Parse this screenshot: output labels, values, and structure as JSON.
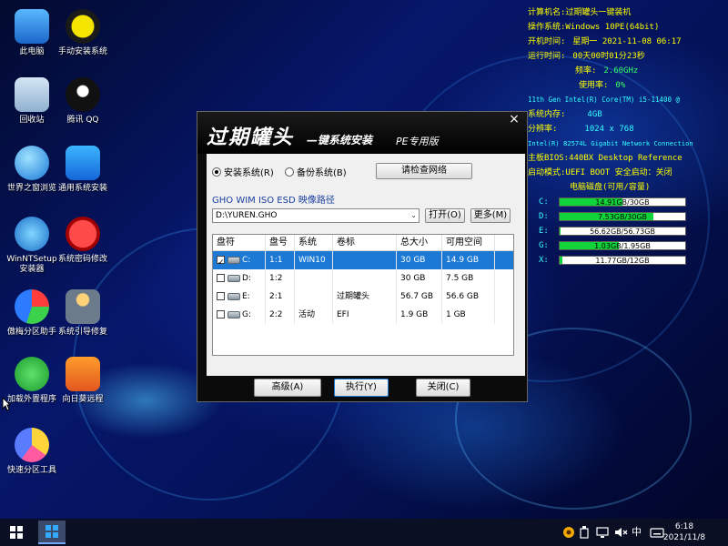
{
  "desktop_icons": [
    {
      "label": "此电脑",
      "icon": "computer-icon"
    },
    {
      "label": "手动安装系统",
      "icon": "ghost-icon"
    },
    {
      "label": "回收站",
      "icon": "recycle-bin-icon"
    },
    {
      "label": "腾讯 QQ",
      "icon": "qq-penguin-icon"
    },
    {
      "label": "世界之窗浏览",
      "icon": "globe-browser-icon"
    },
    {
      "label": "通用系统安装",
      "icon": "windows-install-icon"
    },
    {
      "label": "WinNTSetup",
      "label2": "安装器",
      "icon": "winntsetup-icon"
    },
    {
      "label": "系统密码修改",
      "icon": "key-icon"
    },
    {
      "label": "傲梅分区助手",
      "icon": "partition-assistant-icon"
    },
    {
      "label": "系统引导修复",
      "icon": "repair-man-icon"
    },
    {
      "label": "加载外置程序",
      "icon": "green-arrows-icon"
    },
    {
      "label": "向日葵远程",
      "icon": "sunflower-icon"
    },
    {
      "label": "快速分区工具",
      "icon": "pie-partition-icon"
    }
  ],
  "sysinfo": {
    "rows": [
      {
        "key": "计算机名:",
        "value": "过期罐头一键装机"
      },
      {
        "key": "操作系统:",
        "value": "Windows 10PE(64bit)"
      },
      {
        "key": "开机时间:",
        "value": "星期一  2021-11-08 06:17"
      },
      {
        "key": "运行时间:",
        "value": "00天00时01分23秒"
      }
    ],
    "freq_label": "频率:",
    "freq_value": "2.60GHz",
    "usage_label": "使用率:",
    "usage_value": "0%",
    "cpu_model": "11th Gen Intel(R) Core(TM) i5-11400 @",
    "mem_label": "系统内存:",
    "mem_value": "4GB",
    "res_label": "分辨率:",
    "res_value": "1024 x 768",
    "nic": "Intel(R) 82574L Gigabit Network Connection",
    "bios_label": "主板BIOS:",
    "bios_value": "440BX Desktop Reference",
    "boot_label": "启动模式:",
    "boot_value": "UEFI BOOT 安全启动：关闭",
    "disk_header": "电脑磁盘(可用/容量)",
    "disks": [
      {
        "label": "C:",
        "text": "14.91GB/30GB",
        "fill_fraction": 0.503
      },
      {
        "label": "D:",
        "text": "7.53GB/30GB",
        "fill_fraction": 0.749
      },
      {
        "label": "E:",
        "text": "56.62GB/56.73GB",
        "fill_fraction": 0.002
      },
      {
        "label": "G:",
        "text": "1.03GB/1.95GB",
        "fill_fraction": 0.472
      },
      {
        "label": "X:",
        "text": "11.77GB/12GB",
        "fill_fraction": 0.019
      }
    ]
  },
  "dialog": {
    "title": "过期罐头",
    "subtitle": "—键系统安装",
    "edition": "PE专用版",
    "close_label": "×",
    "radio_install": "安装系统(R)",
    "radio_backup": "备份系统(B)",
    "check_network_label": "请检查网络",
    "path_label": "GHO WIM ISO ESD 映像路径",
    "path_value": "D:\\YUREN.GHO",
    "open_label": "打开(O)",
    "more_label": "更多(M)",
    "columns": [
      "盘符",
      "盘号",
      "系统",
      "卷标",
      "总大小",
      "可用空间"
    ],
    "rows": [
      {
        "checked": true,
        "drive": "C:",
        "num": "1:1",
        "system": "WIN10",
        "label": "",
        "total": "30 GB",
        "free": "14.9 GB",
        "selected": true
      },
      {
        "checked": false,
        "drive": "D:",
        "num": "1:2",
        "system": "",
        "label": "",
        "total": "30 GB",
        "free": "7.5 GB",
        "selected": false
      },
      {
        "checked": false,
        "drive": "E:",
        "num": "2:1",
        "system": "",
        "label": "过期罐头",
        "total": "56.7 GB",
        "free": "56.6 GB",
        "selected": false
      },
      {
        "checked": false,
        "drive": "G:",
        "num": "2:2",
        "system": "活动",
        "label": "EFI",
        "total": "1.9 GB",
        "free": "1 GB",
        "selected": false
      }
    ],
    "advanced_label": "高级(A)",
    "execute_label": "执行(Y)",
    "close_btn_label": "关闭(C)"
  },
  "taskbar": {
    "ime": "中",
    "clock_time": "6:18",
    "clock_date": "2021/11/8"
  }
}
